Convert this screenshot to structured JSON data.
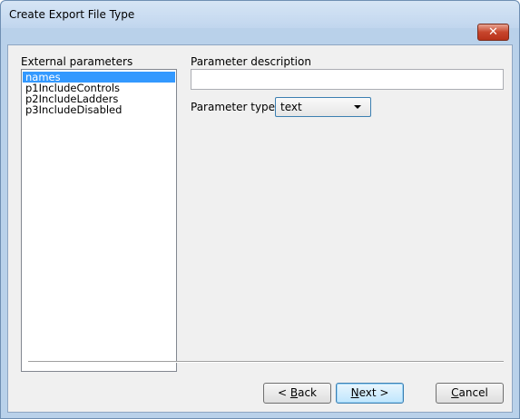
{
  "window": {
    "title": "Create Export File Type",
    "close_glyph": "✕"
  },
  "external_parameters": {
    "label": "External parameters",
    "items": [
      "names",
      "p1IncludeControls",
      "p2IncludeLadders",
      "p3IncludeDisabled"
    ],
    "selected_index": 0
  },
  "parameter_description": {
    "label": "Parameter description",
    "value": ""
  },
  "parameter_type": {
    "label": "Parameter type",
    "selected": "text"
  },
  "buttons": {
    "back": {
      "prefix": "< ",
      "mnemonic": "B",
      "rest": "ack"
    },
    "next": {
      "mnemonic": "N",
      "rest": "ext >"
    },
    "cancel": {
      "mnemonic": "C",
      "rest": "ancel"
    }
  },
  "colors": {
    "selection": "#3399ff",
    "close_button": "#c7452c",
    "window_frame": "#b9d1ea"
  }
}
